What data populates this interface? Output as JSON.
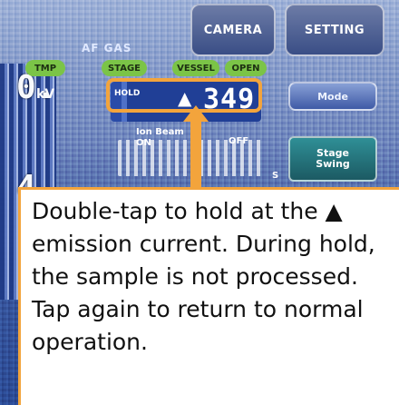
{
  "top_tabs": {
    "camera": "CAMERA",
    "setting": "SETTING"
  },
  "header_label": "AF GAS",
  "status_pills": [
    "TMP",
    "STAGE",
    "VESSEL",
    "OPEN"
  ],
  "left_readout": {
    "value_top": "0.",
    "unit": "kV",
    "value_bottom": "4"
  },
  "hold": {
    "label": "HOLD",
    "arrow": "▲",
    "value": "349"
  },
  "ion_beam": {
    "label_line1": "Ion Beam",
    "label_line2": "ON",
    "off_label": "OFF",
    "s_label": "S"
  },
  "buttons": {
    "mode": "Mode",
    "stage_swing_line1": "Stage",
    "stage_swing_line2": "Swing"
  },
  "callout": {
    "text": "Double-tap to hold at the ▲ emission current. During hold, the sample is not processed. Tap again to return to normal operation."
  },
  "colors": {
    "accent_orange": "#f3a43c",
    "screen_blue": "#2c4b95",
    "status_green": "#7bc447"
  }
}
